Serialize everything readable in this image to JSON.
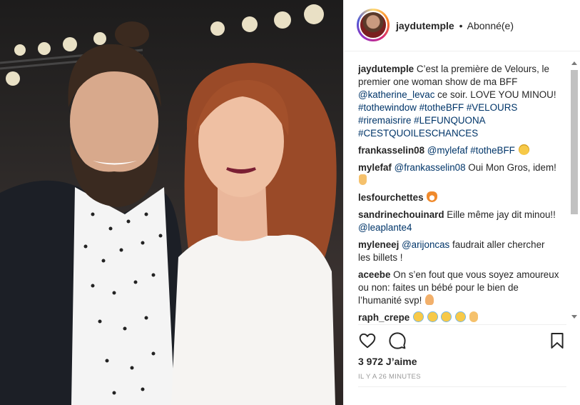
{
  "post": {
    "username": "jaydutemple",
    "separator": "•",
    "follow_status": "Abonné(e)"
  },
  "caption": {
    "username": "jaydutemple",
    "text_before": "C’est la première de Velours, le premier one woman show de ma BFF ",
    "mention": "@katherine_levac",
    "text_after": " ce soir. LOVE YOU MINOU! ",
    "tags": "#tothewindow #totheBFF #VELOURS #riremaisrire #LEFUNQUONA #CESTQUOILESCHANCES"
  },
  "comments": [
    {
      "username": "frankasselin08",
      "mention": "@mylefaf",
      "text": "",
      "tags": "#totheBFF",
      "emoji": "sweat-smile"
    },
    {
      "username": "mylefaf",
      "mention": "@frankasselin08",
      "text": " Oui Mon Gros, idem!",
      "tags": "",
      "emoji": "victory-hand"
    },
    {
      "username": "lesfourchettes",
      "mention": "",
      "text": "",
      "tags": "",
      "emoji": "fox"
    },
    {
      "username": "sandrinechouinard",
      "mention": "",
      "text": "Eille même jay dit minou!! ",
      "mention_after": "@leaplante4",
      "tags": "",
      "emoji": ""
    },
    {
      "username": "myleneej",
      "mention": "@arijoncas",
      "text": " faudrait aller chercher les billets !",
      "tags": "",
      "emoji": ""
    },
    {
      "username": "aceebe",
      "mention": "",
      "text": "On s’en fout que vous soyez amoureux ou non: faites un bébé pour le bien de l’humanité svp!",
      "tags": "",
      "emoji": "pray"
    },
    {
      "username": "raph_crepe",
      "mention": "",
      "text": "",
      "tags": "",
      "emoji": "crying-laughing x4, ok-hand"
    }
  ],
  "likes": "3 972 J’aime",
  "timestamp": "IL Y A 26 MINUTES",
  "icons": {
    "like": "heart-icon",
    "comment": "comment-bubble-icon",
    "save": "bookmark-icon"
  },
  "colors": {
    "link": "#003569",
    "text": "#262626",
    "muted": "#999999",
    "border": "#efefef"
  }
}
